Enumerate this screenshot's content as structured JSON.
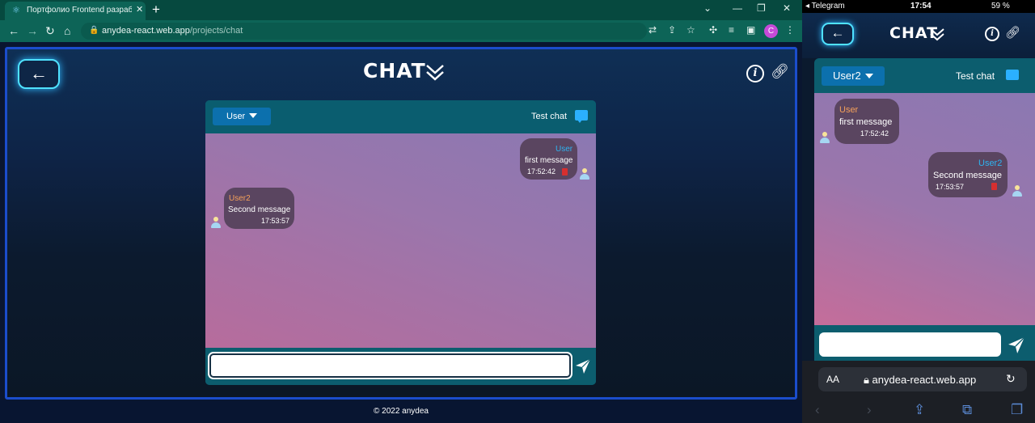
{
  "browser": {
    "tab_title": "Портфолио Frontend разработч",
    "url_host": "anydea-react.web.app",
    "url_path": "/projects/chat",
    "profile_initial": "C"
  },
  "app": {
    "title": "CHAT",
    "back_icon": "arrow-left-icon",
    "footer": "© 2022 anydea"
  },
  "chat": {
    "current_user": "User",
    "chat_name": "Test chat",
    "input_value": "",
    "messages": [
      {
        "author": "User",
        "text": "first message",
        "time": "17:52:42",
        "own": true
      },
      {
        "author": "User2",
        "text": "Second message",
        "time": "17:53:57",
        "own": false
      }
    ]
  },
  "mobile": {
    "status": {
      "carrier": "◂ Telegram",
      "time": "17:54",
      "battery": "59 %"
    },
    "current_user": "User2",
    "chat_name": "Test chat",
    "messages": [
      {
        "author": "User",
        "text": "first message",
        "time": "17:52:42",
        "own": false
      },
      {
        "author": "User2",
        "text": "Second message",
        "time": "17:53:57",
        "own": true
      }
    ],
    "safari": {
      "aa": "AA",
      "url": "anydea-react.web.app"
    }
  },
  "colors": {
    "accent_glow": "#4fe2ff",
    "own_author": "#2eb3f0",
    "other_author": "#f5a15a",
    "trash": "#d72f2f"
  }
}
